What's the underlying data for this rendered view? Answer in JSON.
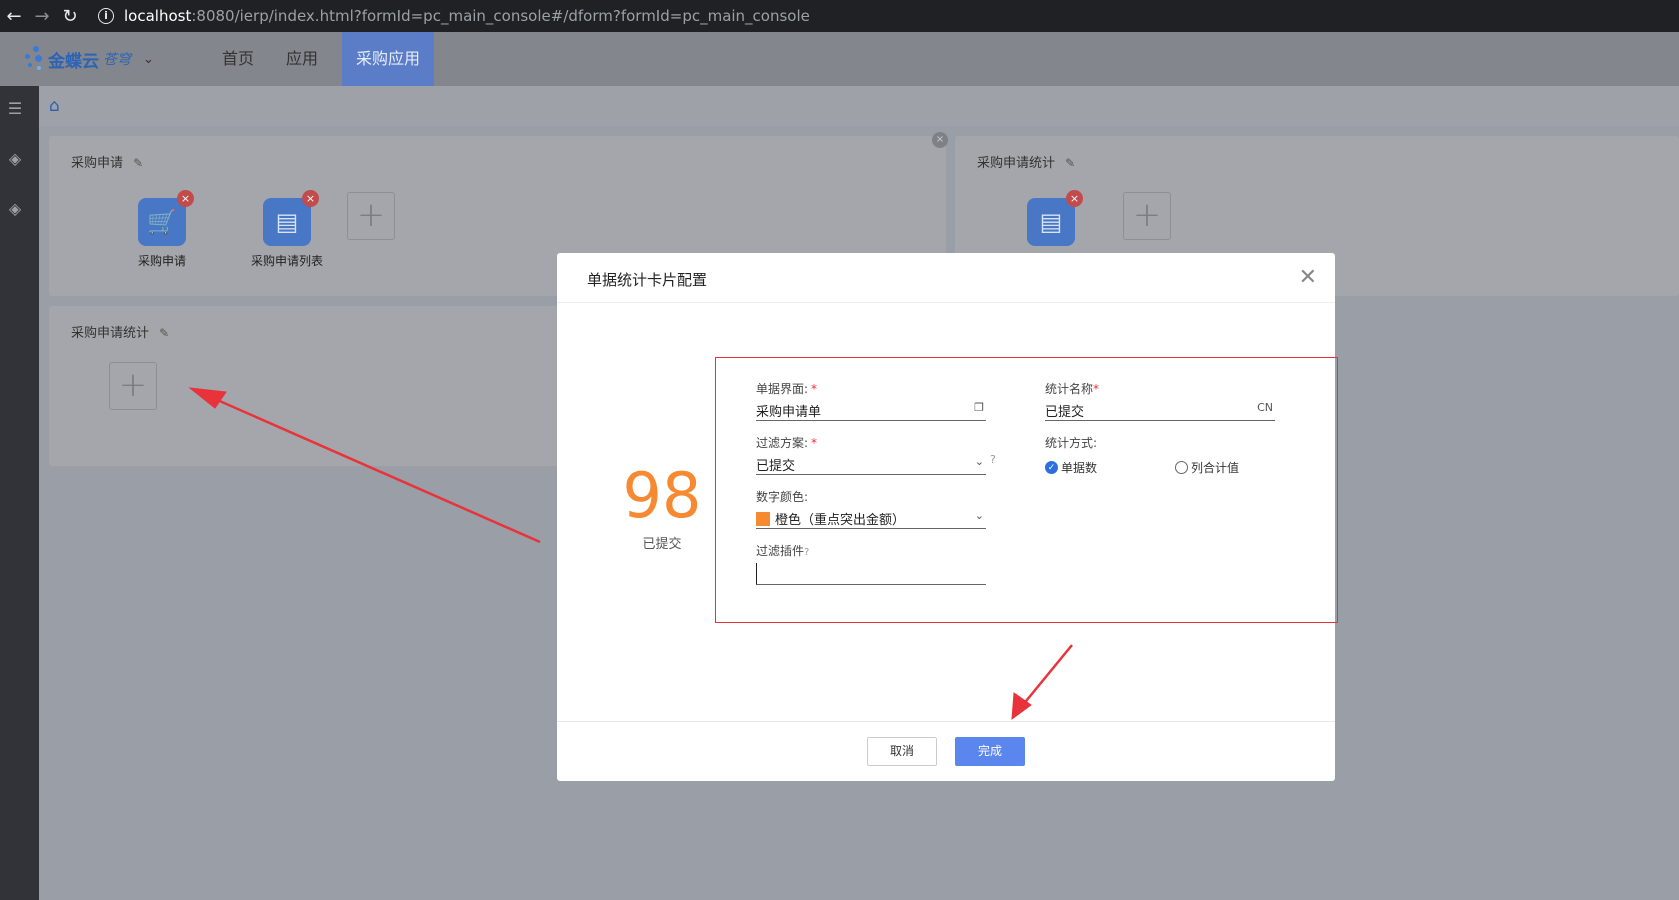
{
  "browser": {
    "url_host": "localhost",
    "url_rest": ":8080/ierp/index.html?formId=pc_main_console#/dform?formId=pc_main_console"
  },
  "app": {
    "logo_text": "金蝶云",
    "logo_sub": "苍穹",
    "nav": [
      "首页",
      "应用",
      "采购应用"
    ]
  },
  "cards": {
    "purchase_request": {
      "title": "采购申请",
      "apps": [
        "采购申请",
        "采购申请列表"
      ]
    },
    "purchase_stats_right": {
      "title": "采购申请统计"
    },
    "purchase_stats_left": {
      "title": "采购申请统计"
    }
  },
  "modal": {
    "title": "单据统计卡片配置",
    "preview_number": "98",
    "preview_caption": "已提交",
    "form": {
      "bill_label": "单据界面:",
      "bill_value": "采购申请单",
      "filter_label": "过滤方案:",
      "filter_value": "已提交",
      "color_label": "数字颜色:",
      "color_value": "橙色（重点突出金额）",
      "plugin_label": "过滤插件",
      "plugin_value": "",
      "stat_name_label": "统计名称",
      "stat_name_value": "已提交",
      "stat_name_lang": "CN",
      "stat_method_label": "统计方式:",
      "stat_method_opt1": "单据数",
      "stat_method_opt2": "列合计值"
    },
    "cancel": "取消",
    "ok": "完成"
  },
  "colors": {
    "accent": "#5b86ee",
    "number": "#f58a33",
    "annotation": "#e8333a"
  }
}
